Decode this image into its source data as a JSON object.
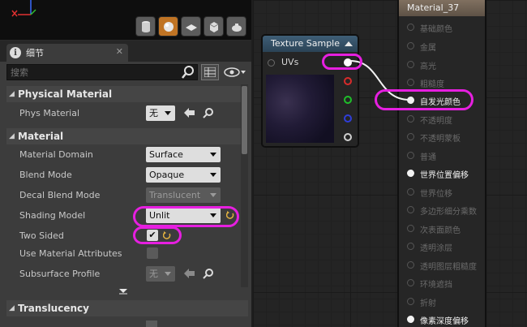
{
  "details_tab": {
    "label": "细节",
    "icon": "info-icon",
    "close": "✕"
  },
  "search": {
    "placeholder": "搜索"
  },
  "sections": {
    "physical_material": {
      "title": "Physical Material",
      "rows": [
        {
          "label": "Phys Material",
          "value": "无"
        }
      ]
    },
    "material": {
      "title": "Material",
      "rows": [
        {
          "label": "Material Domain",
          "value": "Surface"
        },
        {
          "label": "Blend Mode",
          "value": "Opaque"
        },
        {
          "label": "Decal Blend Mode",
          "value": "Translucent"
        },
        {
          "label": "Shading Model",
          "value": "Unlit"
        },
        {
          "label": "Two Sided",
          "value": "✔"
        },
        {
          "label": "Use Material Attributes",
          "value": ""
        },
        {
          "label": "Subsurface Profile",
          "value": "无"
        }
      ]
    },
    "translucency": {
      "title": "Translucency"
    }
  },
  "texture_node": {
    "title": "Texture Sample",
    "input": "UVs",
    "output_pin_colors": [
      "#ffffff",
      "#d82b2b",
      "#1fbf2a",
      "#2f3ed8",
      "#d0d0d0"
    ]
  },
  "material_node": {
    "title": "Material_37",
    "inputs": [
      {
        "label": "基础颜色",
        "active": false
      },
      {
        "label": "金属",
        "active": false
      },
      {
        "label": "高光",
        "active": false
      },
      {
        "label": "粗糙度",
        "active": false
      },
      {
        "label": "自发光颜色",
        "active": true
      },
      {
        "label": "不透明度",
        "active": false
      },
      {
        "label": "不透明蒙板",
        "active": false
      },
      {
        "label": "普通",
        "active": false
      },
      {
        "label": "世界位置偏移",
        "active": true
      },
      {
        "label": "世界位移",
        "active": false
      },
      {
        "label": "多边形细分乘数",
        "active": false
      },
      {
        "label": "次表面颜色",
        "active": false
      },
      {
        "label": "透明涂层",
        "active": false
      },
      {
        "label": "透明图层粗糙度",
        "active": false
      },
      {
        "label": "环境遮挡",
        "active": false
      },
      {
        "label": "折射",
        "active": false
      },
      {
        "label": "像素深度偏移",
        "active": true
      }
    ]
  },
  "colors": {
    "highlight": "#e61fe0",
    "accent": "#c07424",
    "wire": "#f2f2f2"
  }
}
